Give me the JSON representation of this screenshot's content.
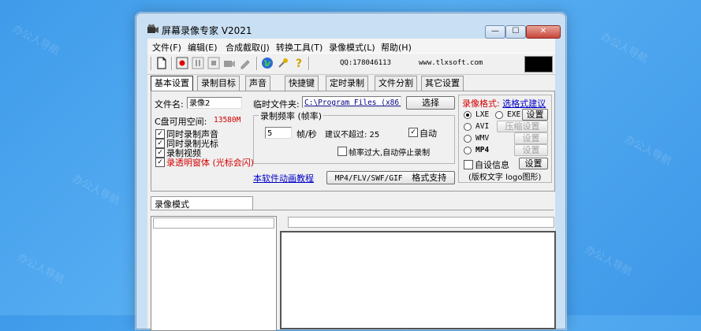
{
  "window": {
    "title": "屏幕录像专家 V2021",
    "min_label": "—",
    "max_label": "☐",
    "close_label": "✕"
  },
  "menu": [
    "文件(F)",
    "编辑(E)",
    "合成截取(J)",
    "转换工具(T)",
    "录像模式(L)",
    "帮助(H)"
  ],
  "toolbar": {
    "qq": "QQ:178046113",
    "site": "www.tlxsoft.com"
  },
  "tabs": [
    "基本设置",
    "录制目标",
    "声音",
    "快捷键",
    "定时录制",
    "文件分割",
    "其它设置"
  ],
  "basic": {
    "filename_label": "文件名:",
    "filename_value": "录像2",
    "temp_label": "临时文件夹:",
    "temp_value": "C:\\Program Files (x86)\\",
    "select_button": "选择",
    "disk_label": "C盘可用空间:",
    "disk_value": "13580M",
    "checks": [
      {
        "label": "同时录制声音",
        "checked": true,
        "red": false
      },
      {
        "label": "同时录制光标",
        "checked": true,
        "red": false
      },
      {
        "label": "录制视频",
        "checked": true,
        "red": false
      },
      {
        "label": "录透明窗体 (光标会闪)",
        "checked": true,
        "red": true
      }
    ],
    "freq_title": "录制频率 (帧率)",
    "fps_value": "5",
    "fps_unit": "帧/秒",
    "suggest": "建议不超过: 25",
    "auto_label": "自动",
    "auto_checked": true,
    "stop_label": "帧率过大,自动停止录制",
    "stop_checked": false,
    "anim_link": "本软件动画教程",
    "format_support_prefix": "MP4/FLV/SWF/GIF",
    "format_support_suffix": "格式支持",
    "format_title": "录像格式:",
    "format_link": "选格式建议",
    "formats": [
      {
        "name": "LXE",
        "selected": true
      },
      {
        "name": "EXE",
        "selected": false
      },
      {
        "name": "AVI",
        "selected": false
      },
      {
        "name": "WMV",
        "selected": false
      },
      {
        "name": "MP4",
        "selected": false
      }
    ],
    "settings_button": "设置",
    "compress_button": "压缩设置",
    "self_info": "自设信息",
    "logo_note": "(版权文字 logo图形)"
  },
  "mode_tab": "录像模式",
  "watermark": "办公人导航"
}
